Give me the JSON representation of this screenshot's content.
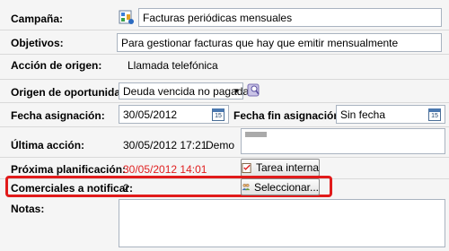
{
  "form": {
    "campana": {
      "label": "Campaña:",
      "value": "Facturas periódicas mensuales"
    },
    "objetivos": {
      "label": "Objetivos:",
      "value": "Para gestionar facturas que hay que emitir mensualmente"
    },
    "accion_origen": {
      "label": "Acción de origen:",
      "value": "Llamada telefónica"
    },
    "origen_oportunidad": {
      "label": "Origen de oportunidad:",
      "value": "Deuda vencida no pagada"
    },
    "fecha_asignacion": {
      "label": "Fecha asignación:",
      "value": "30/05/2012"
    },
    "fecha_fin": {
      "label": "Fecha fin asignación:",
      "value": "Sin fecha"
    },
    "ultima_accion": {
      "label": "Última acción:",
      "date": "30/05/2012 17:21",
      "user": "Demo"
    },
    "proxima_planificacion": {
      "label": "Próxima planificación:",
      "value": "30/05/2012 14:01",
      "color": "#e02020"
    },
    "tarea_button": "Tarea interna",
    "comerciales": {
      "label": "Comerciales a notificar:",
      "value": "2"
    },
    "seleccionar_button": "Seleccionar...",
    "notas": {
      "label": "Notas:",
      "value": ""
    },
    "calendar_icon_text": "15"
  },
  "colors": {
    "highlight": "#e11b1b",
    "accent_red": "#e02020"
  }
}
